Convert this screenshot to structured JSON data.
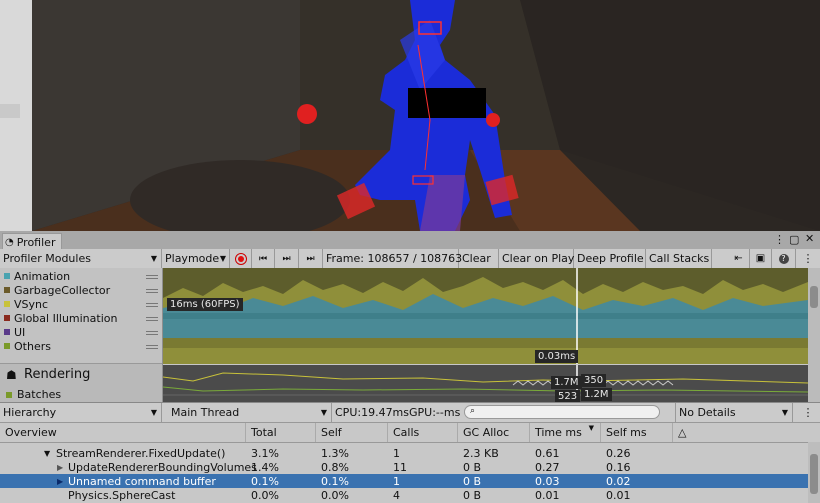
{
  "profiler": {
    "tab_title": "Profiler",
    "toolbar": {
      "modules_label": "Profiler Modules",
      "mode": "Playmode",
      "frame": "Frame: 108657 / 108763",
      "clear": "Clear",
      "clear_on_play": "Clear on Play",
      "deep_profile": "Deep Profile",
      "call_stacks": "Call Stacks"
    },
    "modules": [
      {
        "label": "Animation",
        "color": "#4aa3b0"
      },
      {
        "label": "GarbageCollector",
        "color": "#6b5a2a"
      },
      {
        "label": "VSync",
        "color": "#c8c23a"
      },
      {
        "label": "Global Illumination",
        "color": "#8a2a1e"
      },
      {
        "label": "UI",
        "color": "#5a3a8a"
      },
      {
        "label": "Others",
        "color": "#7a9a2a"
      }
    ],
    "rendering": {
      "title": "Rendering",
      "item": "Batches"
    },
    "chart_labels": {
      "fps": "16ms (60FPS)",
      "cursor": "0.03ms",
      "r1": "1.7M",
      "r2": "350",
      "r3": "523",
      "r4": "1.2M"
    },
    "bottom": {
      "view": "Hierarchy",
      "thread": "Main Thread",
      "cpu": "CPU:19.47ms",
      "gpu": "GPU:--ms",
      "details": "No Details"
    },
    "columns": [
      "Overview",
      "Total",
      "Self",
      "Calls",
      "GC Alloc",
      "Time ms",
      "Self ms"
    ],
    "rows": [
      {
        "name": "StreamRenderer.FixedUpdate()",
        "total": "3.1%",
        "self": "1.3%",
        "calls": "1",
        "gc": "2.3 KB",
        "time": "0.61",
        "selfms": "0.26"
      },
      {
        "name": "UpdateRendererBoundingVolumes",
        "total": "1.4%",
        "self": "0.8%",
        "calls": "11",
        "gc": "0 B",
        "time": "0.27",
        "selfms": "0.16"
      },
      {
        "name": "Unnamed command buffer",
        "total": "0.1%",
        "self": "0.1%",
        "calls": "1",
        "gc": "0 B",
        "time": "0.03",
        "selfms": "0.02"
      },
      {
        "name": "Physics.SphereCast",
        "total": "0.0%",
        "self": "0.0%",
        "calls": "4",
        "gc": "0 B",
        "time": "0.01",
        "selfms": "0.01"
      }
    ]
  }
}
